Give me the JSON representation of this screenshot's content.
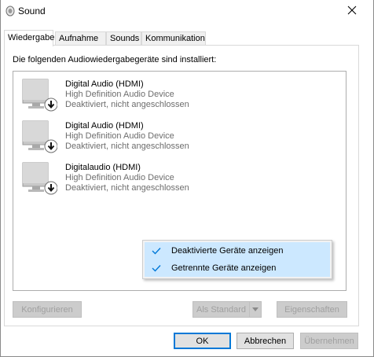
{
  "window": {
    "title": "Sound",
    "icon": "speaker-icon",
    "close_icon": "close-icon"
  },
  "tabs": [
    {
      "label": "Wiedergabe",
      "active": true
    },
    {
      "label": "Aufnahme",
      "active": false
    },
    {
      "label": "Sounds",
      "active": false
    },
    {
      "label": "Kommunikation",
      "active": false
    }
  ],
  "panel": {
    "caption": "Die folgenden Audiowiedergabegeräte sind installiert:"
  },
  "devices": [
    {
      "name": "Digital Audio (HDMI)",
      "description": "High Definition Audio Device",
      "state": "Deaktiviert, nicht angeschlossen",
      "icon": "monitor-disabled-icon"
    },
    {
      "name": "Digital Audio (HDMI)",
      "description": "High Definition Audio Device",
      "state": "Deaktiviert, nicht angeschlossen",
      "icon": "monitor-disabled-icon"
    },
    {
      "name": "Digitalaudio (HDMI)",
      "description": "High Definition Audio Device",
      "state": "Deaktiviert, nicht angeschlossen",
      "icon": "monitor-disabled-icon"
    }
  ],
  "context_menu": {
    "items": [
      {
        "label": "Deaktivierte Geräte anzeigen",
        "checked": true
      },
      {
        "label": "Getrennte Geräte anzeigen",
        "checked": true
      }
    ]
  },
  "panel_buttons": {
    "configure": "Konfigurieren",
    "set_default": "Als Standard",
    "properties": "Eigenschaften"
  },
  "dialog_buttons": {
    "ok": "OK",
    "cancel": "Abbrechen",
    "apply": "Übernehmen"
  },
  "colors": {
    "accent": "#0078d7",
    "menu_highlight": "#cce8ff",
    "disabled_text": "#a0a0a0",
    "secondary_text": "#6d6d6d"
  }
}
